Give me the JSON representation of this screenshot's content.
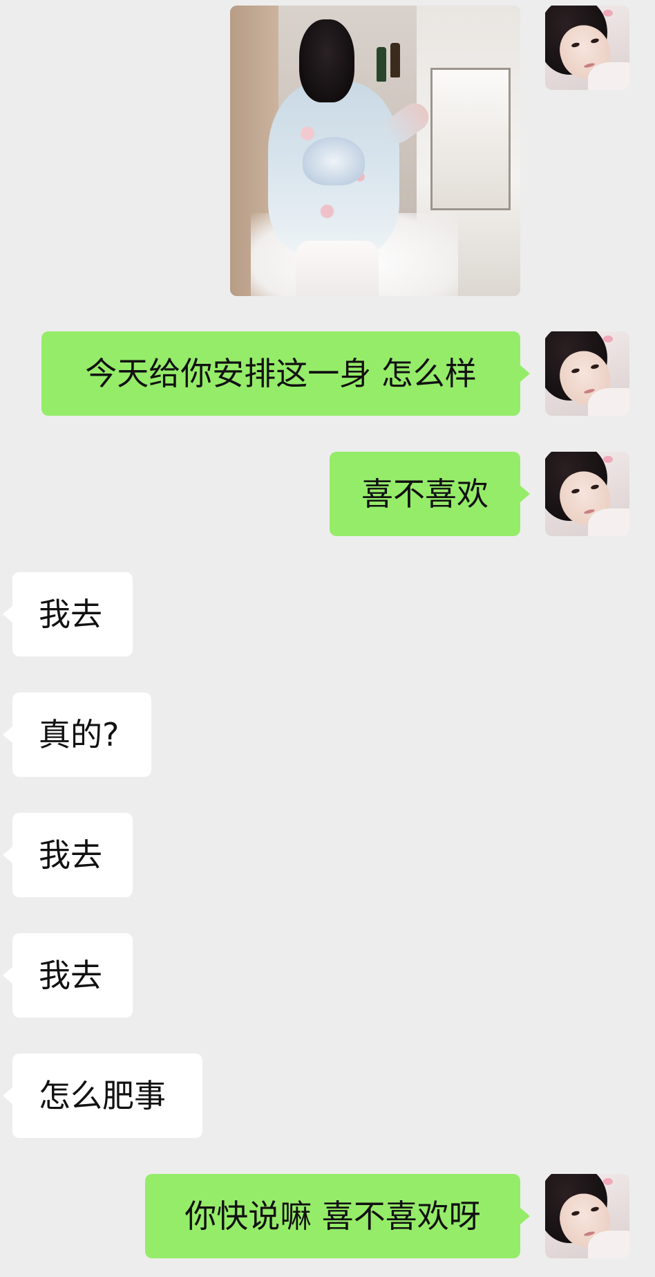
{
  "messages": [
    {
      "sender": "me",
      "type": "image",
      "alt": ""
    },
    {
      "sender": "me",
      "type": "text",
      "text": "今天给你安排这一身 怎么样"
    },
    {
      "sender": "me",
      "type": "text",
      "text": "喜不喜欢"
    },
    {
      "sender": "other",
      "type": "text",
      "text": "我去"
    },
    {
      "sender": "other",
      "type": "text",
      "text": "真的?"
    },
    {
      "sender": "other",
      "type": "text",
      "text": "我去"
    },
    {
      "sender": "other",
      "type": "text",
      "text": "我去"
    },
    {
      "sender": "other",
      "type": "text",
      "text": "怎么肥事"
    },
    {
      "sender": "me",
      "type": "text",
      "text": "你快说嘛 喜不喜欢呀"
    }
  ],
  "colors": {
    "background": "#ededed",
    "my_bubble": "#95ec69",
    "other_bubble": "#ffffff",
    "text": "#111111"
  }
}
